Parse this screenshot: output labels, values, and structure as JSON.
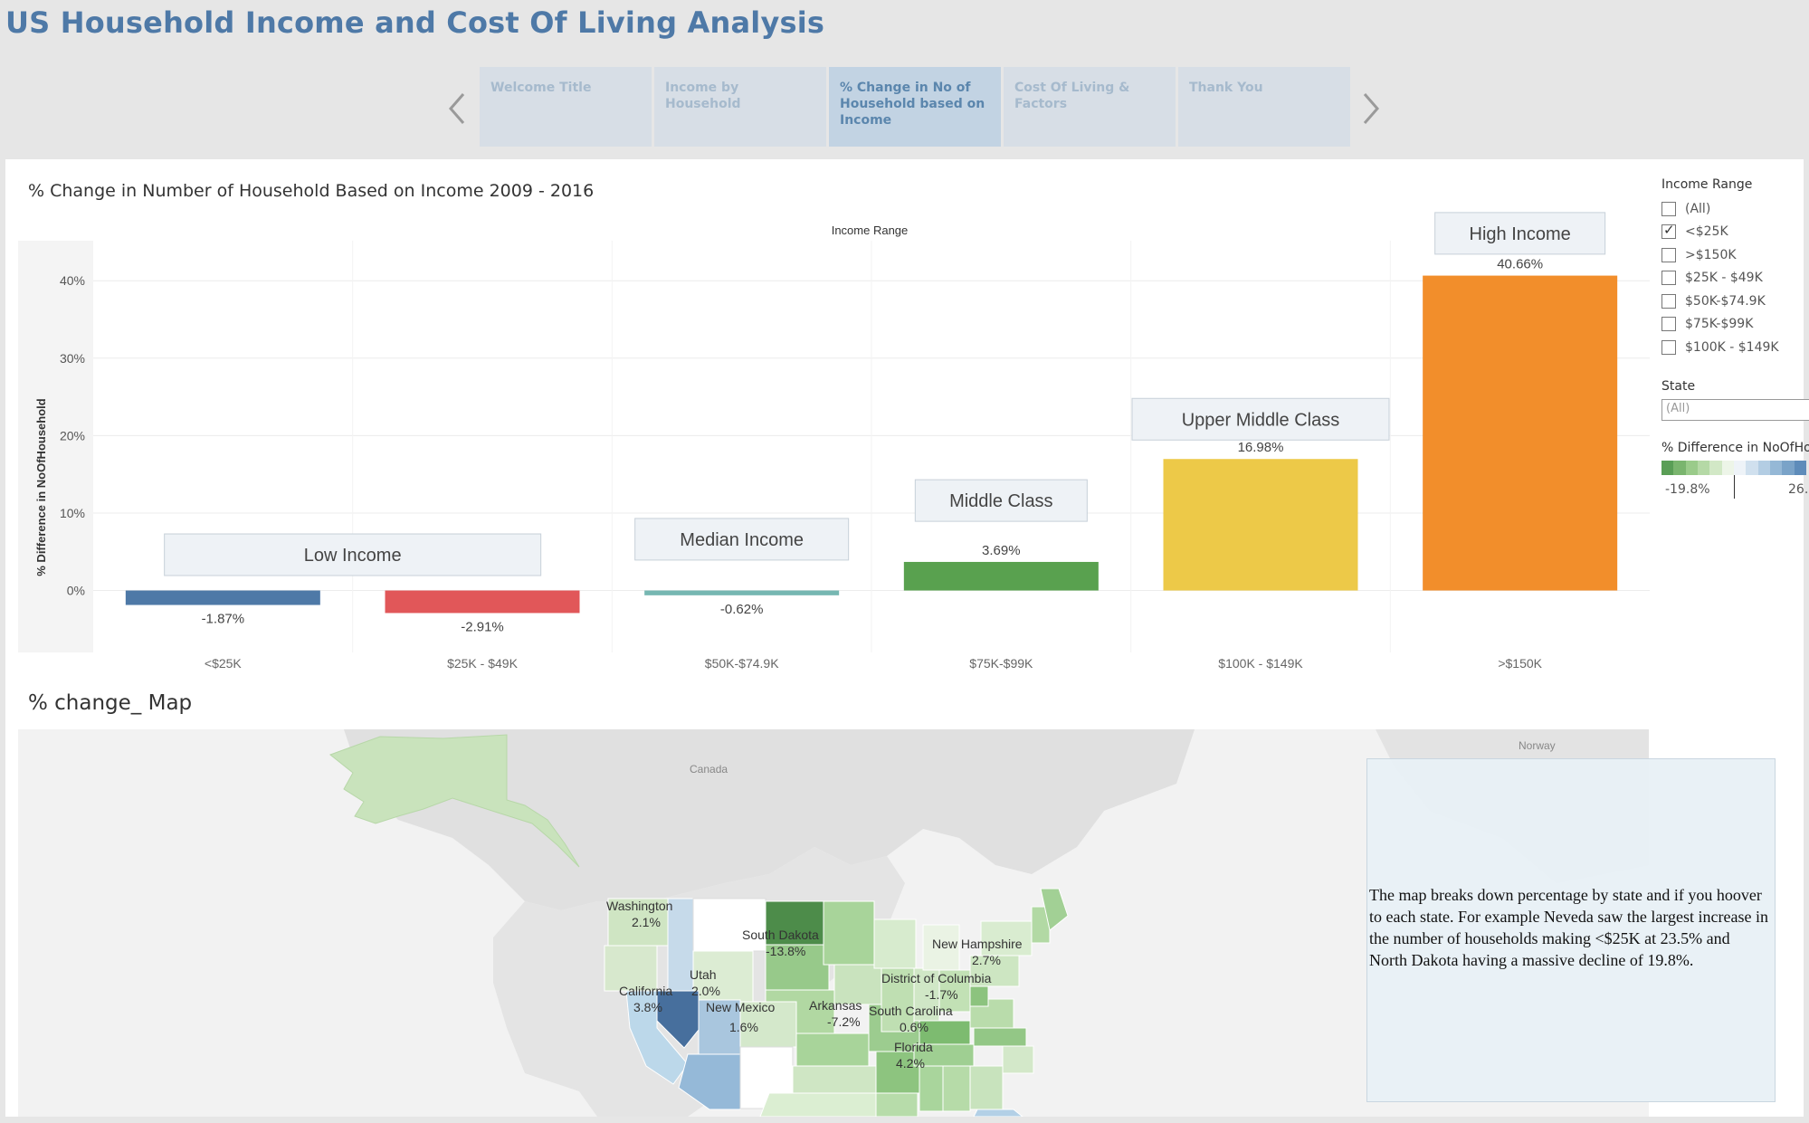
{
  "app": {
    "title": "US Household Income and Cost Of Living Analysis"
  },
  "story_nav": {
    "prev_icon": "chevron-left-icon",
    "next_icon": "chevron-right-icon",
    "points": [
      {
        "label": "Welcome Title",
        "active": false
      },
      {
        "label": "Income by Household",
        "active": false
      },
      {
        "label": "% Change in No of Household based on Income",
        "active": true
      },
      {
        "label": "Cost Of Living & Factors",
        "active": false
      },
      {
        "label": "Thank You",
        "active": false
      }
    ]
  },
  "chart": {
    "title": "% Change in Number of Household Based on Income 2009 - 2016"
  },
  "chart_data": {
    "type": "bar",
    "title": "% Change in Number of Household Based on Income 2009 - 2016",
    "header_label": "Income Range",
    "ylabel": "% Difference in NoOfHousehold",
    "ylim": [
      -8,
      44
    ],
    "yticks": [
      0,
      10,
      20,
      30,
      40
    ],
    "ytick_labels": [
      "0%",
      "10%",
      "20%",
      "30%",
      "40%"
    ],
    "categories": [
      "<$25K",
      "$25K - $49K",
      "$50K-$74.9K",
      "$75K-$99K",
      "$100K - $149K",
      ">$150K"
    ],
    "values": [
      -1.87,
      -2.91,
      -0.62,
      3.69,
      16.98,
      40.66
    ],
    "value_labels": [
      "-1.87%",
      "-2.91%",
      "-0.62%",
      "3.69%",
      "16.98%",
      "40.66%"
    ],
    "colors": [
      "#4e79a7",
      "#e15759",
      "#76b7b2",
      "#59a14f",
      "#edc948",
      "#f28e2b"
    ],
    "annotations": [
      {
        "text": "Low Income",
        "category": "<$25K",
        "value": 4.5
      },
      {
        "text": "Median Income",
        "category": "$50K-$74.9K",
        "value": 6.5
      },
      {
        "text": "Middle Class",
        "category": "$75K-$99K",
        "value": 11.5
      },
      {
        "text": "Upper Middle Class",
        "category": "$100K - $149K",
        "value": 22.0
      },
      {
        "text": "High Income",
        "category": ">$150K",
        "value": 46.0
      }
    ],
    "grid": true
  },
  "filters": {
    "income_range": {
      "heading": "Income Range",
      "options": [
        {
          "label": "(All)",
          "checked": false
        },
        {
          "label": "<$25K",
          "checked": true
        },
        {
          "label": ">$150K",
          "checked": false
        },
        {
          "label": "$25K - $49K",
          "checked": false
        },
        {
          "label": "$50K-$74.9K",
          "checked": false
        },
        {
          "label": "$75K-$99K",
          "checked": false
        },
        {
          "label": "$100K - $149K",
          "checked": false
        }
      ]
    },
    "state": {
      "heading": "State",
      "value": "(All)"
    },
    "color_legend": {
      "heading": "% Difference in NoOfHo",
      "min_label": "-19.8%",
      "max_label": "26.",
      "colors": [
        "#5a9e56",
        "#7ab56e",
        "#9acb8a",
        "#b5d9a6",
        "#d2e8c6",
        "#edf5e8",
        "#eef3f8",
        "#d0e0ee",
        "#b3cde3",
        "#95b8d6",
        "#7aa3c8",
        "#5e8cba"
      ]
    }
  },
  "map": {
    "title": "% change_ Map",
    "labels": [
      "Canada",
      "Norway",
      "Washington",
      "2.1%",
      "South Dakota",
      "-13.8%",
      "New Hampshire",
      "2.7%",
      "Utah",
      "2.0%",
      "District of Columbia",
      "-1.7%",
      "California",
      "3.8%",
      "New Mexico",
      "1.6%",
      "Arkansas",
      "-7.2%",
      "South Carolina",
      "0.6%",
      "Florida",
      "4.2%"
    ],
    "annotation_text": "The map breaks down percentage by state and if you hoover to each state. For example Neveda saw the largest increase in the number of households making <$25K at 23.5% and North Dakota having a massive decline of 19.8%."
  }
}
